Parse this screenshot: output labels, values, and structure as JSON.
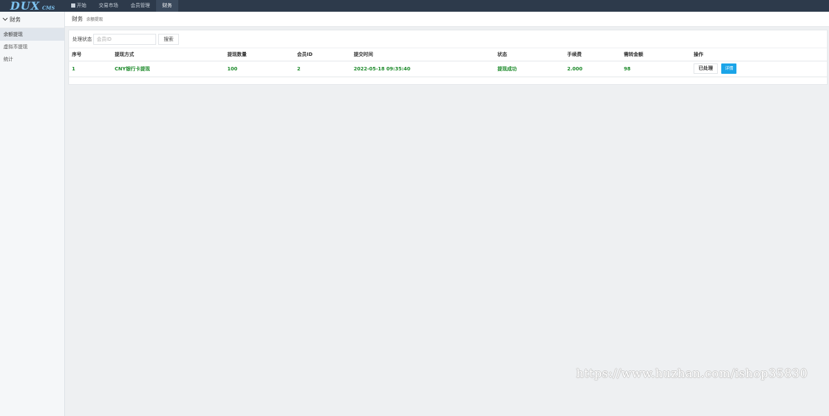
{
  "brand": {
    "logo_main": "DUX",
    "logo_sub": "CMS"
  },
  "nav": {
    "items": [
      {
        "label": "开始",
        "icon": "windows-icon"
      },
      {
        "label": "交易市场"
      },
      {
        "label": "会员管理"
      },
      {
        "label": "财务",
        "active": true
      }
    ]
  },
  "sidebar": {
    "header": "财务",
    "items": [
      {
        "label": "余额提现",
        "active": true
      },
      {
        "label": "虚拟币提现"
      },
      {
        "label": "统计"
      }
    ]
  },
  "breadcrumb": {
    "section": "财务",
    "page": "余额提现"
  },
  "filter": {
    "label": "处理状态",
    "placeholder": "会员ID",
    "search_label": "搜索"
  },
  "table": {
    "headers": [
      "序号",
      "提现方式",
      "提现数量",
      "会员ID",
      "提交时间",
      "状态",
      "手续费",
      "需转金额",
      "操作"
    ],
    "rows": [
      {
        "id": "1",
        "method": "CNY银行卡提现",
        "amount": "100",
        "member_id": "2",
        "submit_time": "2022-05-18 09:35:40",
        "status": "提现成功",
        "fee": "2.000",
        "transfer_amount": "98",
        "action_done": "已处理",
        "action_detail": "详情"
      }
    ]
  },
  "watermark": "https://www.huzhan.com/ishop35830",
  "colors": {
    "topbar": "#2d3a4b",
    "success_text": "#1c8a2a",
    "primary_button": "#1aa4e8"
  }
}
